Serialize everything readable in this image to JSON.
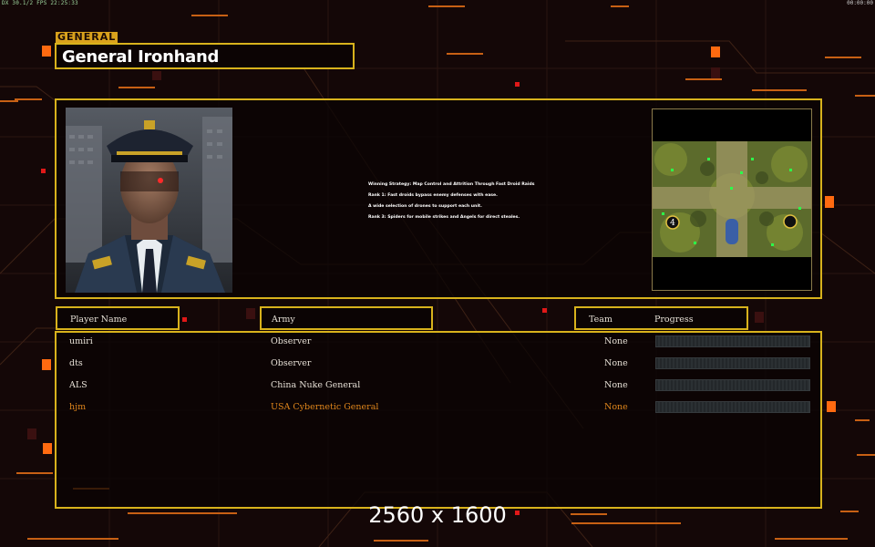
{
  "hud": {
    "top_left": "DX 30.1/2 FPS 22:25:33",
    "top_right": "00:00:00"
  },
  "header": {
    "section_label": "GENERAL",
    "general_name": "General Ironhand"
  },
  "general_info": {
    "strategy_lines": [
      "Winning Strategy: Map Control and Attrition Through Fast Droid Raids",
      "Rank 1: Fast droids bypass enemy defenses with ease.",
      "A wide selection of drones to support each unit.",
      "Rank 3: Spiders for mobile strikes and Angels for direct steales."
    ],
    "minimap": {
      "start_markers": [
        "4"
      ]
    }
  },
  "columns": {
    "player_name": "Player Name",
    "army": "Army",
    "team": "Team",
    "progress": "Progress"
  },
  "players": [
    {
      "name": "umiri",
      "army": "Observer",
      "team": "None",
      "progress": 0,
      "color": "#e6e0d6"
    },
    {
      "name": "dts",
      "army": "Observer",
      "team": "None",
      "progress": 0,
      "color": "#e6e0d6"
    },
    {
      "name": "ALS",
      "army": "China Nuke General",
      "team": "None",
      "progress": 0,
      "color": "#e6e0d6"
    },
    {
      "name": "hjm",
      "army": "USA Cybernetic General",
      "team": "None",
      "progress": 0,
      "color": "#e0861c"
    }
  ],
  "resolution_text": "2560 x 1600",
  "colors": {
    "frame": "#d8b21c",
    "label_bg": "#d9a21c",
    "accent_orange": "#ff6a10",
    "local_player": "#e0861c"
  }
}
